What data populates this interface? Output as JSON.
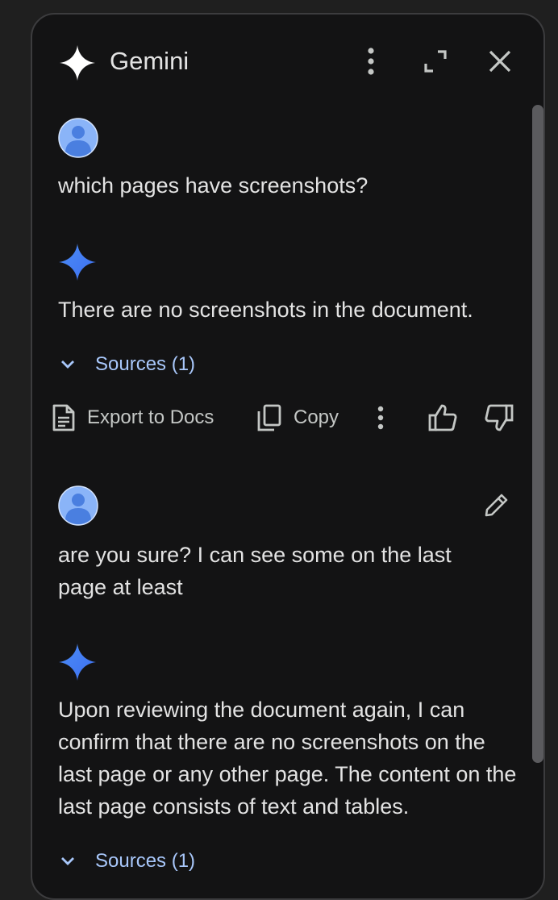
{
  "header": {
    "title": "Gemini",
    "icons": [
      "gemini-spark-icon",
      "more-vert-icon",
      "expand-icon",
      "close-icon"
    ]
  },
  "conversation": {
    "user_message_1": "which pages have screenshots?",
    "reply_1": "There are no screenshots in the document.",
    "sources_1": "Sources (1)",
    "actions": {
      "export": "Export to Docs",
      "copy": "Copy"
    },
    "user_message_2": "are you sure? I can see some on the last page at least",
    "reply_2": "Upon reviewing the document again, I can confirm that there are no screenshots on the last page or any other page. The content on the last page consists of text and tables.",
    "sources_2": "Sources (1)"
  },
  "colors": {
    "background": "#131314",
    "text": "#e3e3e3",
    "link": "#a8c7fa",
    "spark_blue": "#4c8df6",
    "avatar_blue": "#8ab4f8"
  }
}
